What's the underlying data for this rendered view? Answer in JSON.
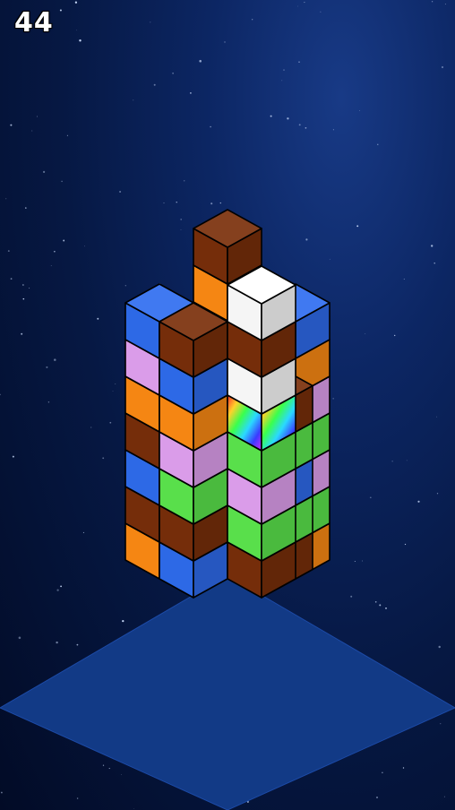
{
  "hud": {
    "score": "44"
  },
  "palette": {
    "brown": "#7a2f0a",
    "orange": "#ff8c14",
    "white": "#ffffff",
    "blue": "#2f6df0",
    "green": "#5de84e",
    "pink": "#e3a2f3",
    "red": "#f20d0d",
    "rainbow": "rainbow",
    "base": "#123a86",
    "outline": "#000000"
  },
  "tower": {
    "columns": [
      {
        "id": "back-left",
        "cubes": [
          "green",
          "blue",
          "brown",
          "orange",
          "blue",
          "white",
          "orange",
          "brown"
        ]
      },
      {
        "id": "back-right",
        "cubes": [
          "orange",
          "green",
          "pink",
          "green",
          "pink",
          "orange",
          "blue"
        ]
      },
      {
        "id": "back-mid",
        "cubes": [
          "pink",
          "blue",
          "green",
          "blue"
        ]
      },
      {
        "id": "mid-left",
        "cubes": [
          "blue",
          "orange",
          "red",
          "green",
          "orange"
        ]
      },
      {
        "id": "mid-inner",
        "cubes": [
          "orange",
          "blue",
          "brown",
          "pink",
          "blue",
          "pink"
        ]
      },
      {
        "id": "mid-right",
        "cubes": [
          "brown",
          "green",
          "pink",
          "green",
          "rainbow",
          "white",
          "brown",
          "white"
        ]
      },
      {
        "id": "mid-right-2",
        "cubes": [
          "brown",
          "green",
          "blue",
          "green",
          "brown"
        ]
      },
      {
        "id": "front-left",
        "cubes": [
          "orange",
          "brown",
          "blue",
          "brown",
          "orange",
          "pink",
          "blue"
        ]
      },
      {
        "id": "front-main",
        "cubes": [
          "blue",
          "brown",
          "green",
          "pink",
          "orange",
          "blue",
          "brown"
        ]
      },
      {
        "id": "falling",
        "cubes": [
          "green",
          "white"
        ]
      }
    ]
  }
}
